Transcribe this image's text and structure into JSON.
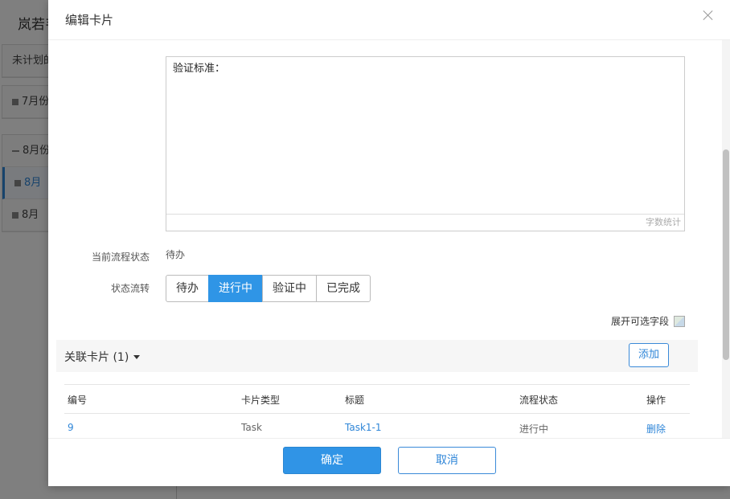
{
  "background": {
    "title": "岚若韦",
    "unplanned": "未计划的",
    "july": "7月份",
    "august": "8月份",
    "august_item_1": "8月",
    "august_item_2": "8月"
  },
  "modal": {
    "title": "编辑卡片",
    "editor": {
      "content": "验证标准：",
      "word_count_label": "字数统计"
    },
    "current_status_label": "当前流程状态",
    "current_status_value": "待办",
    "transition_label": "状态流转",
    "transition_buttons": [
      "待办",
      "进行中",
      "验证中",
      "已完成"
    ],
    "transition_active": "进行中",
    "expand_fields_label": "展开可选字段",
    "related": {
      "title": "关联卡片 (1)",
      "add_label": "添加",
      "columns": [
        "编号",
        "卡片类型",
        "标题",
        "流程状态",
        "操作"
      ],
      "rows": [
        {
          "id": "9",
          "type": "Task",
          "title": "Task1-1",
          "status": "进行中",
          "action": "删除"
        }
      ]
    },
    "footer": {
      "ok_label": "确定",
      "cancel_label": "取消"
    }
  },
  "colors": {
    "primary": "#2f95e6",
    "link": "#2f86d8",
    "overlay": "#7f7f7f"
  }
}
